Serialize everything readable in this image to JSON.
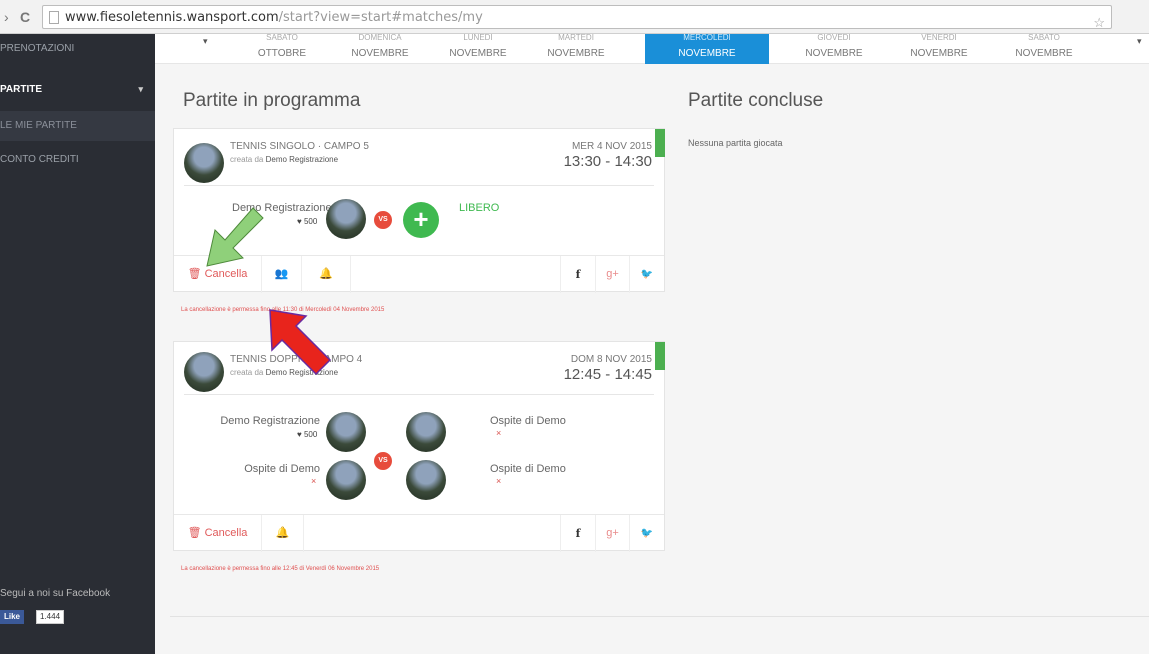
{
  "browser": {
    "url_host": "www.fiesoletennis.wansport.com",
    "url_path": "/start?view=start#matches/my"
  },
  "sidebar": {
    "items": [
      {
        "label": "PRENOTAZIONI"
      },
      {
        "label": "PARTITE"
      },
      {
        "label": "LE MIE PARTITE"
      },
      {
        "label": "CONTO CREDITI"
      }
    ],
    "facebook_text": "Segui a noi su Facebook",
    "like_label": "Like",
    "like_count": "1.444"
  },
  "datebar": {
    "days": [
      {
        "day": "SABATO",
        "month": "OTTOBRE"
      },
      {
        "day": "DOMENICA",
        "month": "NOVEMBRE"
      },
      {
        "day": "LUNEDI",
        "month": "NOVEMBRE"
      },
      {
        "day": "MARTEDI",
        "month": "NOVEMBRE"
      },
      {
        "day": "MERCOLEDI",
        "month": "NOVEMBRE"
      },
      {
        "day": "GIOVEDI",
        "month": "NOVEMBRE"
      },
      {
        "day": "VENERDI",
        "month": "NOVEMBRE"
      },
      {
        "day": "SABATO",
        "month": "NOVEMBRE"
      }
    ]
  },
  "main": {
    "scheduled_title": "Partite in programma",
    "completed_title": "Partite concluse",
    "no_matches": "Nessuna partita giocata"
  },
  "matches": [
    {
      "type": "TENNIS SINGOLO · CAMPO 5",
      "creator_prefix": "creata da",
      "creator": "Demo Registrazione",
      "date": "MER 4 NOV 2015",
      "time": "13:30 - 14:30",
      "player1": "Demo Registrazione",
      "player1_points": "♥ 500",
      "vs": "VS",
      "free_label": "LIBERO",
      "cancel_label": "🗑 Cancella",
      "note": "La cancellazione è permessa fino alle 11:30 di Mercoledì 04 Novembre 2015"
    },
    {
      "type": "TENNIS DOPPIO · CAMPO 4",
      "creator_prefix": "creata da",
      "creator": "Demo Registrazione",
      "date": "DOM 8 NOV 2015",
      "time": "12:45 - 14:45",
      "team1_p1": "Demo Registrazione",
      "team1_p1_points": "♥ 500",
      "team1_p2": "Ospite di Demo",
      "team2_p1": "Ospite di Demo",
      "team2_p2": "Ospite di Demo",
      "x_mark": "×",
      "vs": "VS",
      "cancel_label": "🗑 Cancella",
      "note": "La cancellazione è permessa fino alle 12:45 di Venerdì 06 Novembre 2015"
    }
  ],
  "colors": {
    "sidebar_bg": "#2a2d34",
    "active_date": "#1a8fd8",
    "green": "#4caf50",
    "cancel_red": "#e05a5a"
  }
}
